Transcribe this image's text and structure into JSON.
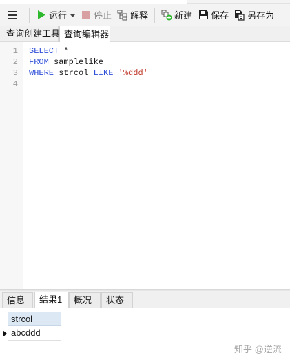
{
  "toolbar": {
    "run_label": "运行",
    "stop_label": "停止",
    "explain_label": "解释",
    "new_label": "新建",
    "save_label": "保存",
    "save_as_label": "另存为"
  },
  "tabs": [
    {
      "label": "查询创建工具",
      "active": false
    },
    {
      "label": "查询编辑器",
      "active": true
    }
  ],
  "editor": {
    "lines": [
      {
        "num": "1",
        "kw": "SELECT",
        "rest": " *"
      },
      {
        "num": "2",
        "kw": "FROM",
        "rest": " samplelike"
      },
      {
        "num": "3",
        "kw": "WHERE",
        "mid": " strcol ",
        "kw2": "LIKE",
        "sp": " ",
        "str": "'%ddd'"
      },
      {
        "num": "4"
      }
    ]
  },
  "bottom_tabs": [
    {
      "label": "信息",
      "active": false
    },
    {
      "label": "结果1",
      "active": true
    },
    {
      "label": "概况",
      "active": false
    },
    {
      "label": "状态",
      "active": false
    }
  ],
  "results": {
    "columns": [
      "strcol"
    ],
    "rows": [
      [
        "abcddd"
      ]
    ]
  },
  "watermark": "知乎 @逆流",
  "colors": {
    "keyword": "#2f4fd8",
    "string": "#c0392b",
    "run_icon": "#2eb82e",
    "stop_icon": "#d8a0a0",
    "grid_header": "#dce9f5"
  }
}
